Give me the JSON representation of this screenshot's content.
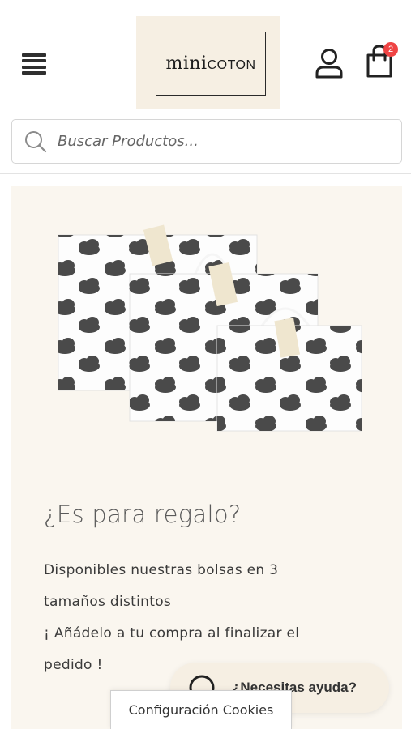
{
  "header": {
    "logo": {
      "text_main": "mini",
      "text_small": "COTON"
    },
    "cart": {
      "count": "2"
    }
  },
  "search": {
    "placeholder": "Buscar Productos..."
  },
  "promo": {
    "title": "¿Es para regalo?",
    "lines": [
      "Disponibles nuestras bolsas en 3",
      "tamaños distintos",
      "¡ Añádelo a tu compra al finalizar el",
      "pedido !"
    ],
    "image_icon": "gift-bags-image"
  },
  "help_button": {
    "label": "¿Necesitas ayuda?",
    "icon": "chat-icon"
  },
  "cookies_button": {
    "label": "Configuración Cookies"
  },
  "colors": {
    "accent_bg": "#f6efe3",
    "badge": "#ef4444",
    "promo_bg": "#faf6ef"
  }
}
